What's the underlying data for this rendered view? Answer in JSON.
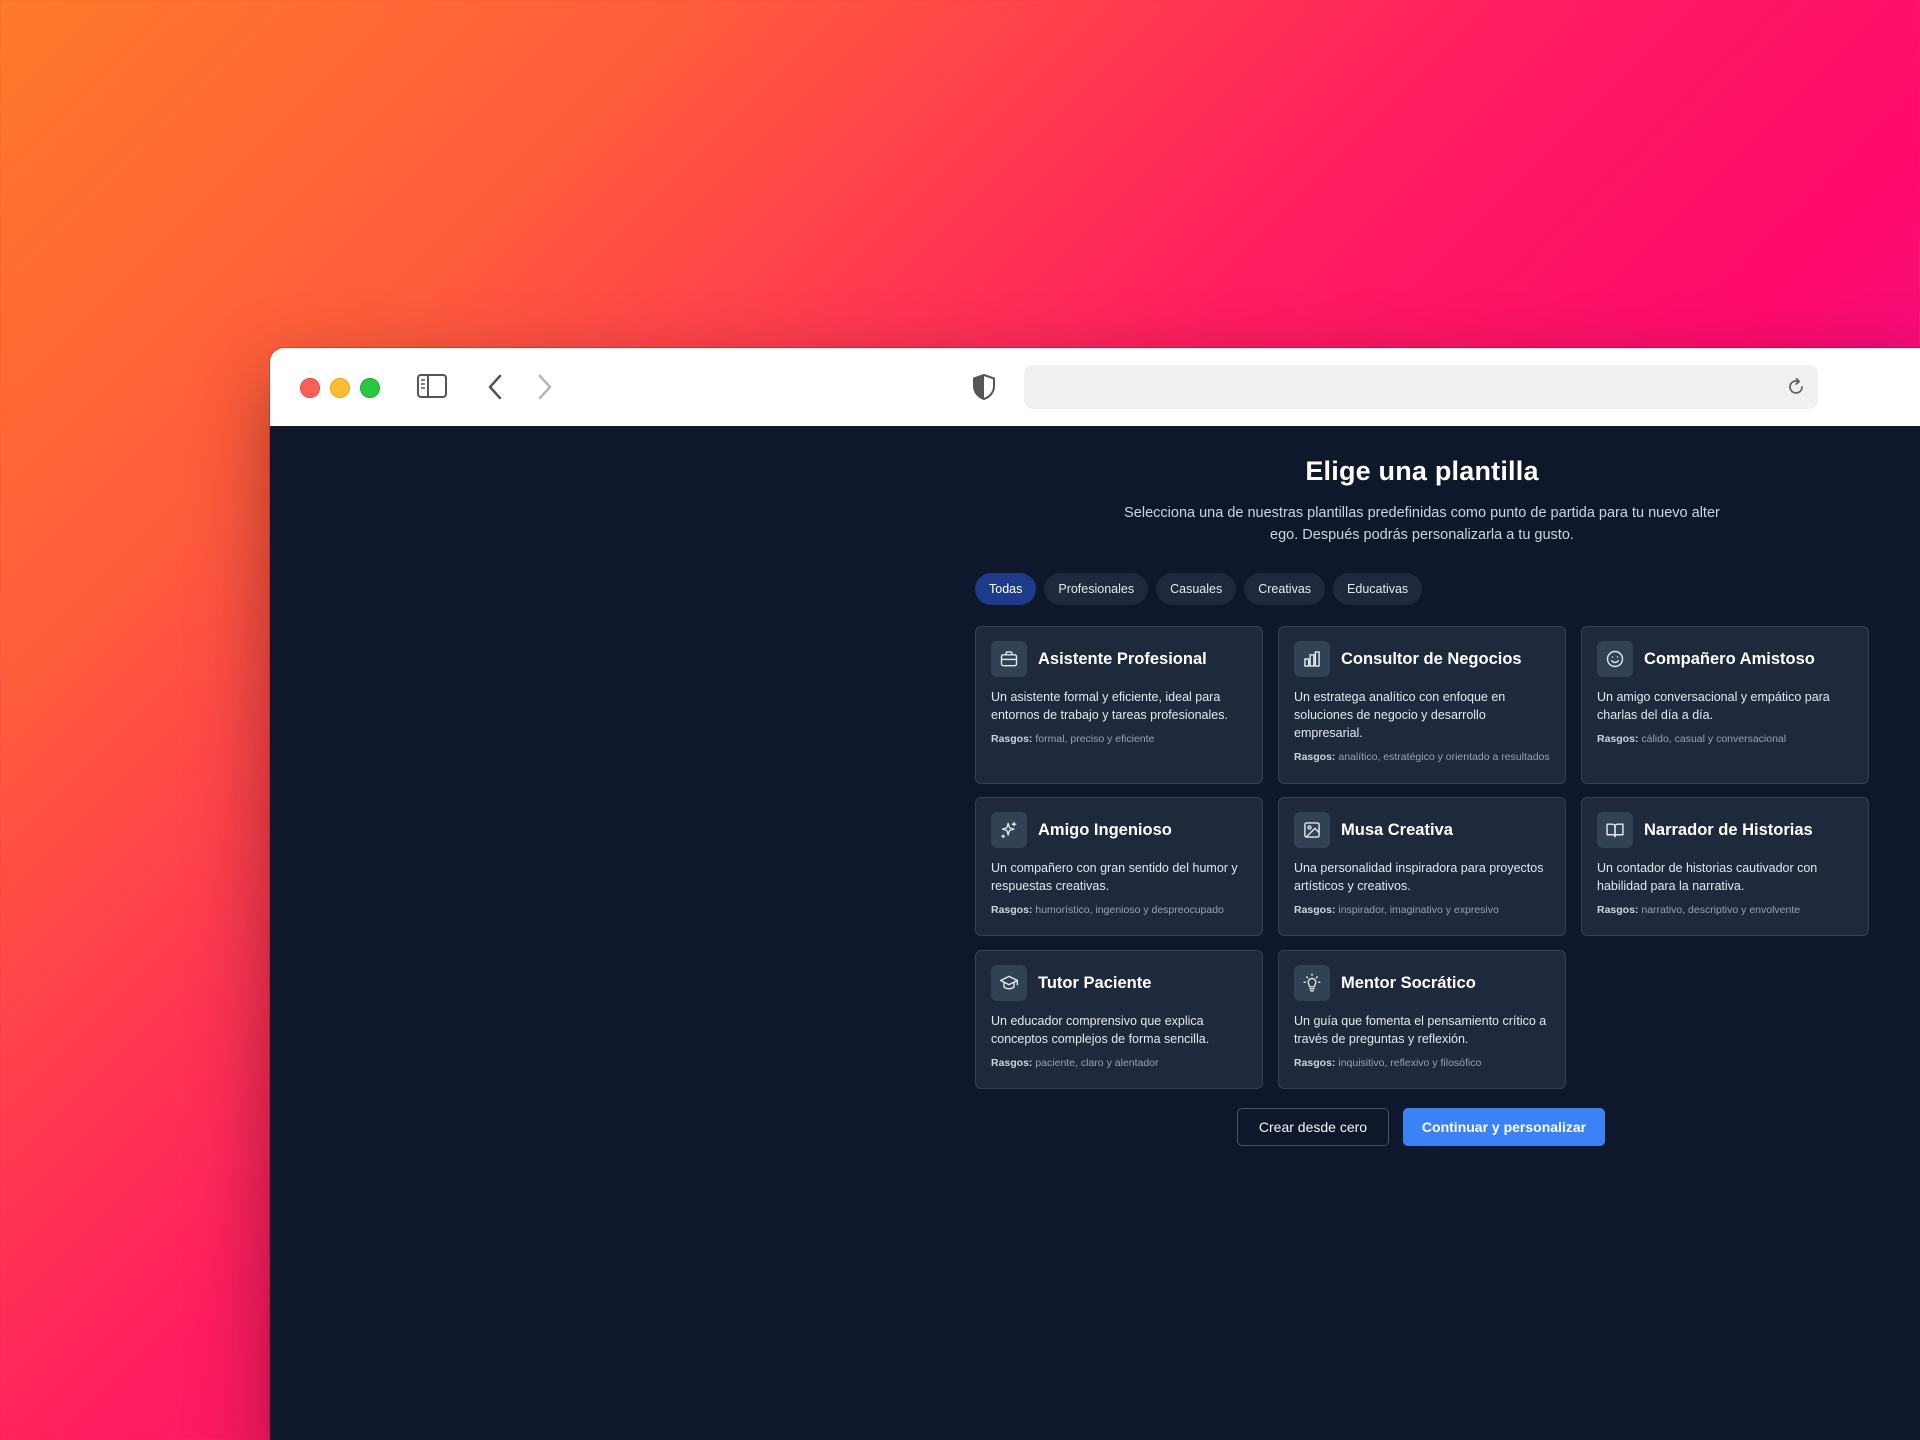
{
  "header": {
    "title": "Elige una plantilla",
    "subtitle": "Selecciona una de nuestras plantillas predefinidas como punto de partida para tu nuevo alter ego. Después podrás personalizarla a tu gusto."
  },
  "filters": [
    {
      "label": "Todas",
      "active": true
    },
    {
      "label": "Profesionales",
      "active": false
    },
    {
      "label": "Casuales",
      "active": false
    },
    {
      "label": "Creativas",
      "active": false
    },
    {
      "label": "Educativas",
      "active": false
    }
  ],
  "traits_label": "Rasgos:",
  "templates": [
    {
      "icon": "briefcase-icon",
      "title": "Asistente Profesional",
      "description": "Un asistente formal y eficiente, ideal para entornos de trabajo y tareas profesionales.",
      "traits": "formal, preciso y eficiente"
    },
    {
      "icon": "bar-chart-icon",
      "title": "Consultor de Negocios",
      "description": "Un estratega analítico con enfoque en soluciones de negocio y desarrollo empresarial.",
      "traits": "analítico, estratégico y orientado a resultados"
    },
    {
      "icon": "smile-icon",
      "title": "Compañero Amistoso",
      "description": "Un amigo conversacional y empático para charlas del día a día.",
      "traits": "cálido, casual y conversacional"
    },
    {
      "icon": "sparkles-icon",
      "title": "Amigo Ingenioso",
      "description": "Un compañero con gran sentido del humor y respuestas creativas.",
      "traits": "humorístico, ingenioso y despreocupado"
    },
    {
      "icon": "image-icon",
      "title": "Musa Creativa",
      "description": "Una personalidad inspiradora para proyectos artísticos y creativos.",
      "traits": "inspirador, imaginativo y expresivo"
    },
    {
      "icon": "open-book-icon",
      "title": "Narrador de Historias",
      "description": "Un contador de historias cautivador con habilidad para la narrativa.",
      "traits": "narrativo, descriptivo y envolvente"
    },
    {
      "icon": "graduation-cap-icon",
      "title": "Tutor Paciente",
      "description": "Un educador comprensivo que explica conceptos complejos de forma sencilla.",
      "traits": "paciente, claro y alentador"
    },
    {
      "icon": "lightbulb-icon",
      "title": "Mentor Socrático",
      "description": "Un guía que fomenta el pensamiento crítico a través de preguntas y reflexión.",
      "traits": "inquisitivo, reflexivo y filosófico"
    }
  ],
  "actions": {
    "secondary_label": "Crear desde cero",
    "primary_label": "Continuar y personalizar"
  },
  "colors": {
    "background": "#0f172a",
    "card": "#1e293b",
    "accent": "#3b82f6",
    "active_pill": "#1e3a8a"
  }
}
